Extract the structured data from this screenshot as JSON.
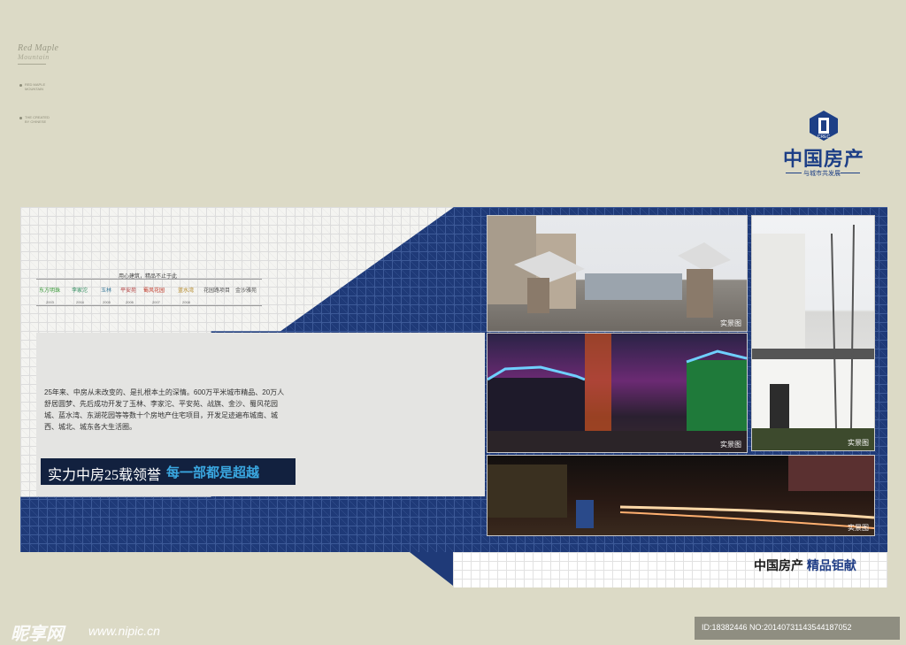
{
  "brand": {
    "title": "Red Maple",
    "subtitle": "Mountain",
    "note1": "RED MAPLE MOUNTAIN",
    "note2": "THE CREATED BY CHINESE"
  },
  "logo": {
    "name": "中国房产",
    "tagline": "与城市共发展",
    "mark": "CREC"
  },
  "timeline": {
    "title": "用心建筑，精品不止于此",
    "logos": [
      "东方明珠",
      "李家沱",
      "玉林",
      "平安苑",
      "蜀风花园",
      "蓝水湾",
      "花园路项目",
      "金沙雅苑"
    ],
    "years": [
      "2003",
      "2004",
      "2005",
      "2006",
      "2007",
      "2008"
    ]
  },
  "intro": "25年来、中房从未改变的、是扎根本土的深情。600万平米城市精品、20万人舒居圆梦、先后成功开发了玉林、李家沱、平安苑、战旗、金沙、蜀风花园城、蓝水湾、东湖花园等等数十个房地产住宅项目，开发足迹遍布城南、城西、城北、城东各大生活圈。",
  "slogan": {
    "part1": "实力中房25载领誉",
    "part2": "每一部都是超越"
  },
  "photos": {
    "caption": "实景图"
  },
  "footer": {
    "brand": "中国房产",
    "tagline": "精品钜献"
  },
  "watermark": {
    "left": "昵享网",
    "url": "www.nipic.cn",
    "right": "ID:18382446 NO:20140731143544187052"
  },
  "colors": {
    "background": "#dcdac6",
    "navy": "#1f3a78",
    "accent": "#3aa7e0"
  }
}
